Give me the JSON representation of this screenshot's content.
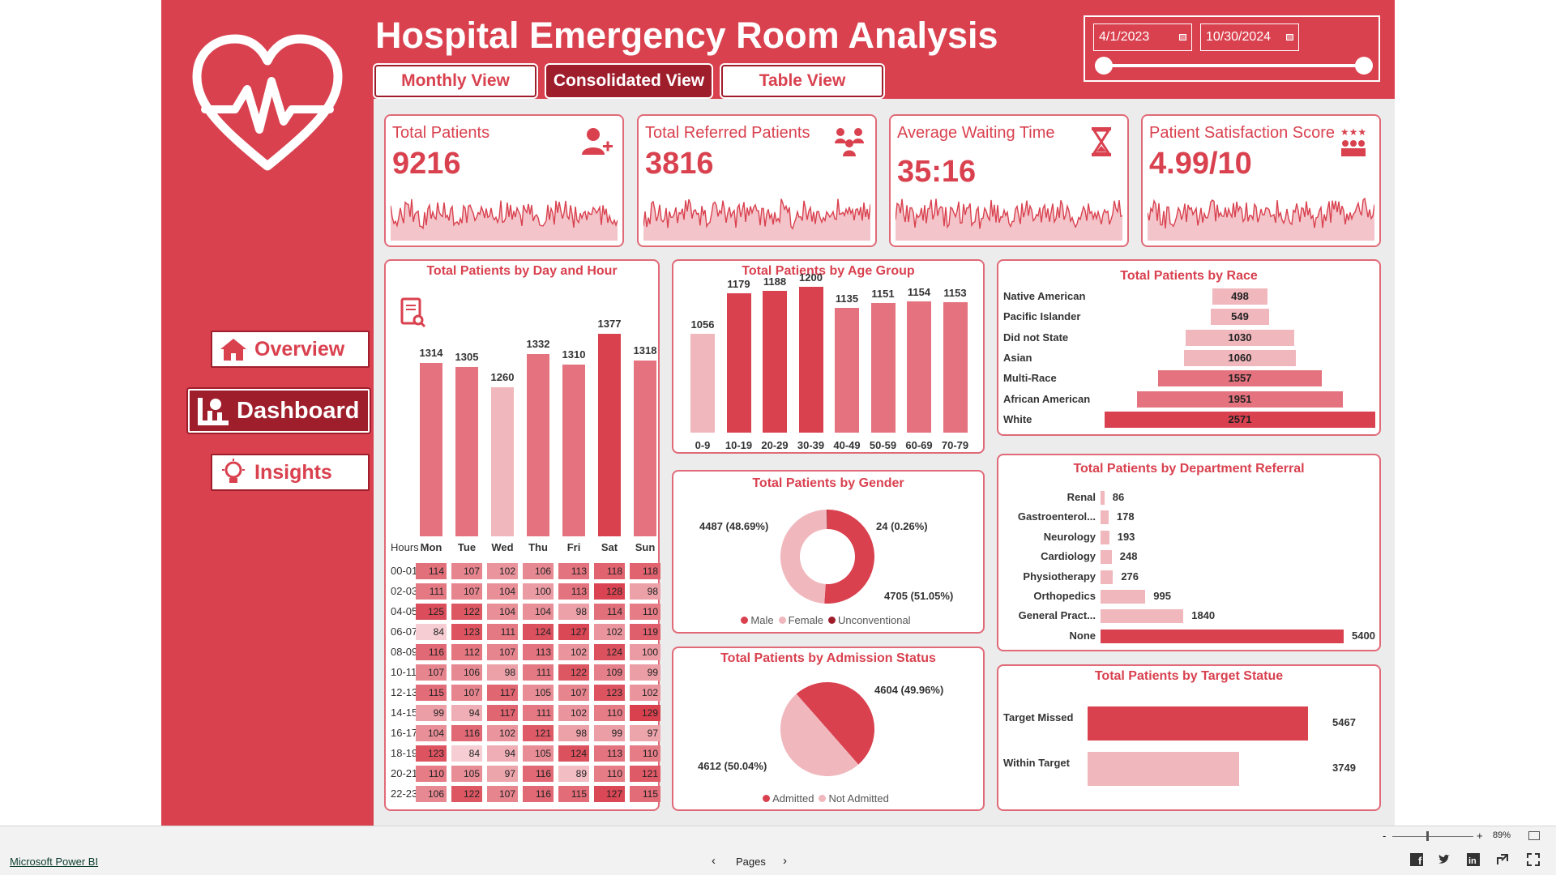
{
  "header": {
    "title": "Hospital Emergency Room Analysis",
    "tabs": [
      {
        "label": "Monthly View",
        "active": false
      },
      {
        "label": "Consolidated View",
        "active": true
      },
      {
        "label": "Table View",
        "active": false
      }
    ],
    "date_from": "4/1/2023",
    "date_to": "10/30/2024"
  },
  "sidebar": {
    "nav": [
      {
        "label": "Overview",
        "icon": "home-icon",
        "active": false
      },
      {
        "label": "Dashboard",
        "icon": "dashboard-icon",
        "active": true
      },
      {
        "label": "Insights",
        "icon": "lightbulb-icon",
        "active": false
      }
    ]
  },
  "kpis": [
    {
      "label": "Total Patients",
      "value": "9216",
      "icon": "patient-add-icon"
    },
    {
      "label": "Total Referred Patients",
      "value": "3816",
      "icon": "referral-group-icon"
    },
    {
      "label": "Average Waiting Time",
      "value": "35:16",
      "icon": "hourglass-icon"
    },
    {
      "label": "Patient Satisfaction Score",
      "value": "4.99/10",
      "icon": "satisfaction-stars-icon"
    }
  ],
  "colors": {
    "brand": "#d9414f",
    "dark": "#9f1e2c",
    "light": "#f0b7bd",
    "mid": "#e4737f",
    "background": "#ececec"
  },
  "chart_data": [
    {
      "type": "bar",
      "title": "Total Patients by Day and Hour",
      "categories": [
        "Mon",
        "Tue",
        "Wed",
        "Thu",
        "Fri",
        "Sat",
        "Sun"
      ],
      "values": [
        1314,
        1305,
        1260,
        1332,
        1310,
        1377,
        1318
      ],
      "heatmap": {
        "row_header": "Hours",
        "rows": [
          "00-01",
          "02-03",
          "04-05",
          "06-07",
          "08-09",
          "10-11",
          "12-13",
          "14-15",
          "16-17",
          "18-19",
          "20-21",
          "22-23"
        ],
        "values": [
          [
            114,
            107,
            102,
            106,
            113,
            118,
            118
          ],
          [
            111,
            107,
            104,
            100,
            113,
            128,
            98
          ],
          [
            125,
            122,
            104,
            104,
            98,
            114,
            110
          ],
          [
            84,
            123,
            111,
            124,
            127,
            102,
            119
          ],
          [
            116,
            112,
            107,
            113,
            102,
            124,
            100
          ],
          [
            107,
            106,
            98,
            111,
            122,
            109,
            99
          ],
          [
            115,
            107,
            117,
            105,
            107,
            123,
            102
          ],
          [
            99,
            94,
            117,
            111,
            102,
            110,
            129
          ],
          [
            104,
            116,
            102,
            121,
            98,
            99,
            97
          ],
          [
            123,
            84,
            94,
            105,
            124,
            113,
            110
          ],
          [
            110,
            105,
            97,
            116,
            89,
            110,
            121
          ],
          [
            106,
            122,
            107,
            116,
            115,
            127,
            115
          ]
        ]
      }
    },
    {
      "type": "bar",
      "title": "Total Patients by Age Group",
      "categories": [
        "0-9",
        "10-19",
        "20-29",
        "30-39",
        "40-49",
        "50-59",
        "60-69",
        "70-79"
      ],
      "values": [
        1056,
        1179,
        1188,
        1200,
        1135,
        1151,
        1154,
        1153
      ]
    },
    {
      "type": "bar",
      "orientation": "horizontal",
      "title": "Total Patients by Race",
      "categories": [
        "Native American",
        "Pacific Islander",
        "Did not State",
        "Asian",
        "Multi-Race",
        "African American",
        "White"
      ],
      "values": [
        498,
        549,
        1030,
        1060,
        1557,
        1951,
        2571
      ]
    },
    {
      "type": "pie",
      "style": "donut",
      "title": "Total Patients by Gender",
      "categories": [
        "Male",
        "Female",
        "Unconventional"
      ],
      "values": [
        4705,
        4487,
        24
      ],
      "labels": [
        "4705 (51.05%)",
        "4487 (48.69%)",
        "24 (0.26%)"
      ]
    },
    {
      "type": "bar",
      "orientation": "horizontal",
      "title": "Total Patients by Department Referral",
      "categories": [
        "Renal",
        "Gastroenterol...",
        "Neurology",
        "Cardiology",
        "Physiotherapy",
        "Orthopedics",
        "General Pract...",
        "None"
      ],
      "values": [
        86,
        178,
        193,
        248,
        276,
        995,
        1840,
        5400
      ]
    },
    {
      "type": "pie",
      "title": "Total Patients by Admission Status",
      "categories": [
        "Admitted",
        "Not Admitted"
      ],
      "values": [
        4612,
        4604
      ],
      "labels": [
        "4612 (50.04%)",
        "4604 (49.96%)"
      ]
    },
    {
      "type": "bar",
      "orientation": "horizontal",
      "title": "Total Patients by Target Statue",
      "categories": [
        "Target Missed",
        "Within Target"
      ],
      "values": [
        5467,
        3749
      ]
    }
  ],
  "statusbar": {
    "app_link": "Microsoft Power BI",
    "pages_label": "Pages",
    "zoom": "89%",
    "zoom_minus": "-",
    "zoom_plus": "+"
  }
}
